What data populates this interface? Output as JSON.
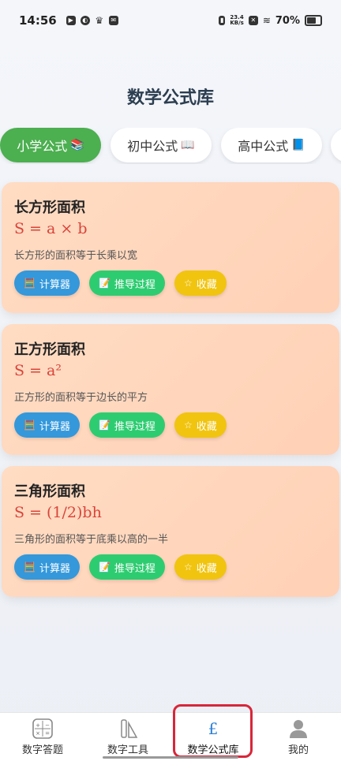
{
  "status_bar": {
    "time": "14:56",
    "net_speed_value": "23.4",
    "net_speed_unit": "KB/s",
    "battery": "70%"
  },
  "page": {
    "title": "数学公式库"
  },
  "tabs": [
    {
      "label": "小学公式",
      "emoji": "📚",
      "active": true
    },
    {
      "label": "初中公式",
      "emoji": "📖",
      "active": false
    },
    {
      "label": "高中公式",
      "emoji": "📘",
      "active": false
    }
  ],
  "cards": [
    {
      "title": "长方形面积",
      "formula": "S = a × b",
      "desc": "长方形的面积等于长乘以宽"
    },
    {
      "title": "正方形面积",
      "formula": "S = a²",
      "desc": "正方形的面积等于边长的平方"
    },
    {
      "title": "三角形面积",
      "formula": "S = (1/2)bh",
      "desc": "三角形的面积等于底乘以高的一半"
    }
  ],
  "card_buttons": {
    "calculator_label": "计算器",
    "calculator_icon": "🧮",
    "derivation_label": "推导过程",
    "derivation_icon": "📝",
    "favorite_label": "收藏",
    "favorite_icon": "☆"
  },
  "bottom_nav": [
    {
      "label": "数字答题",
      "icon": "calculator-icon"
    },
    {
      "label": "数字工具",
      "icon": "tools-icon"
    },
    {
      "label": "数学公式库",
      "icon": "pound-icon",
      "active": true
    },
    {
      "label": "我的",
      "icon": "user-icon"
    }
  ],
  "colors": {
    "accent_green": "#4caf50",
    "formula_red": "#d9443a",
    "btn_blue": "#3498db",
    "btn_green": "#2ecc71",
    "btn_yellow": "#f1c40f",
    "highlight_red": "#d8263a"
  }
}
